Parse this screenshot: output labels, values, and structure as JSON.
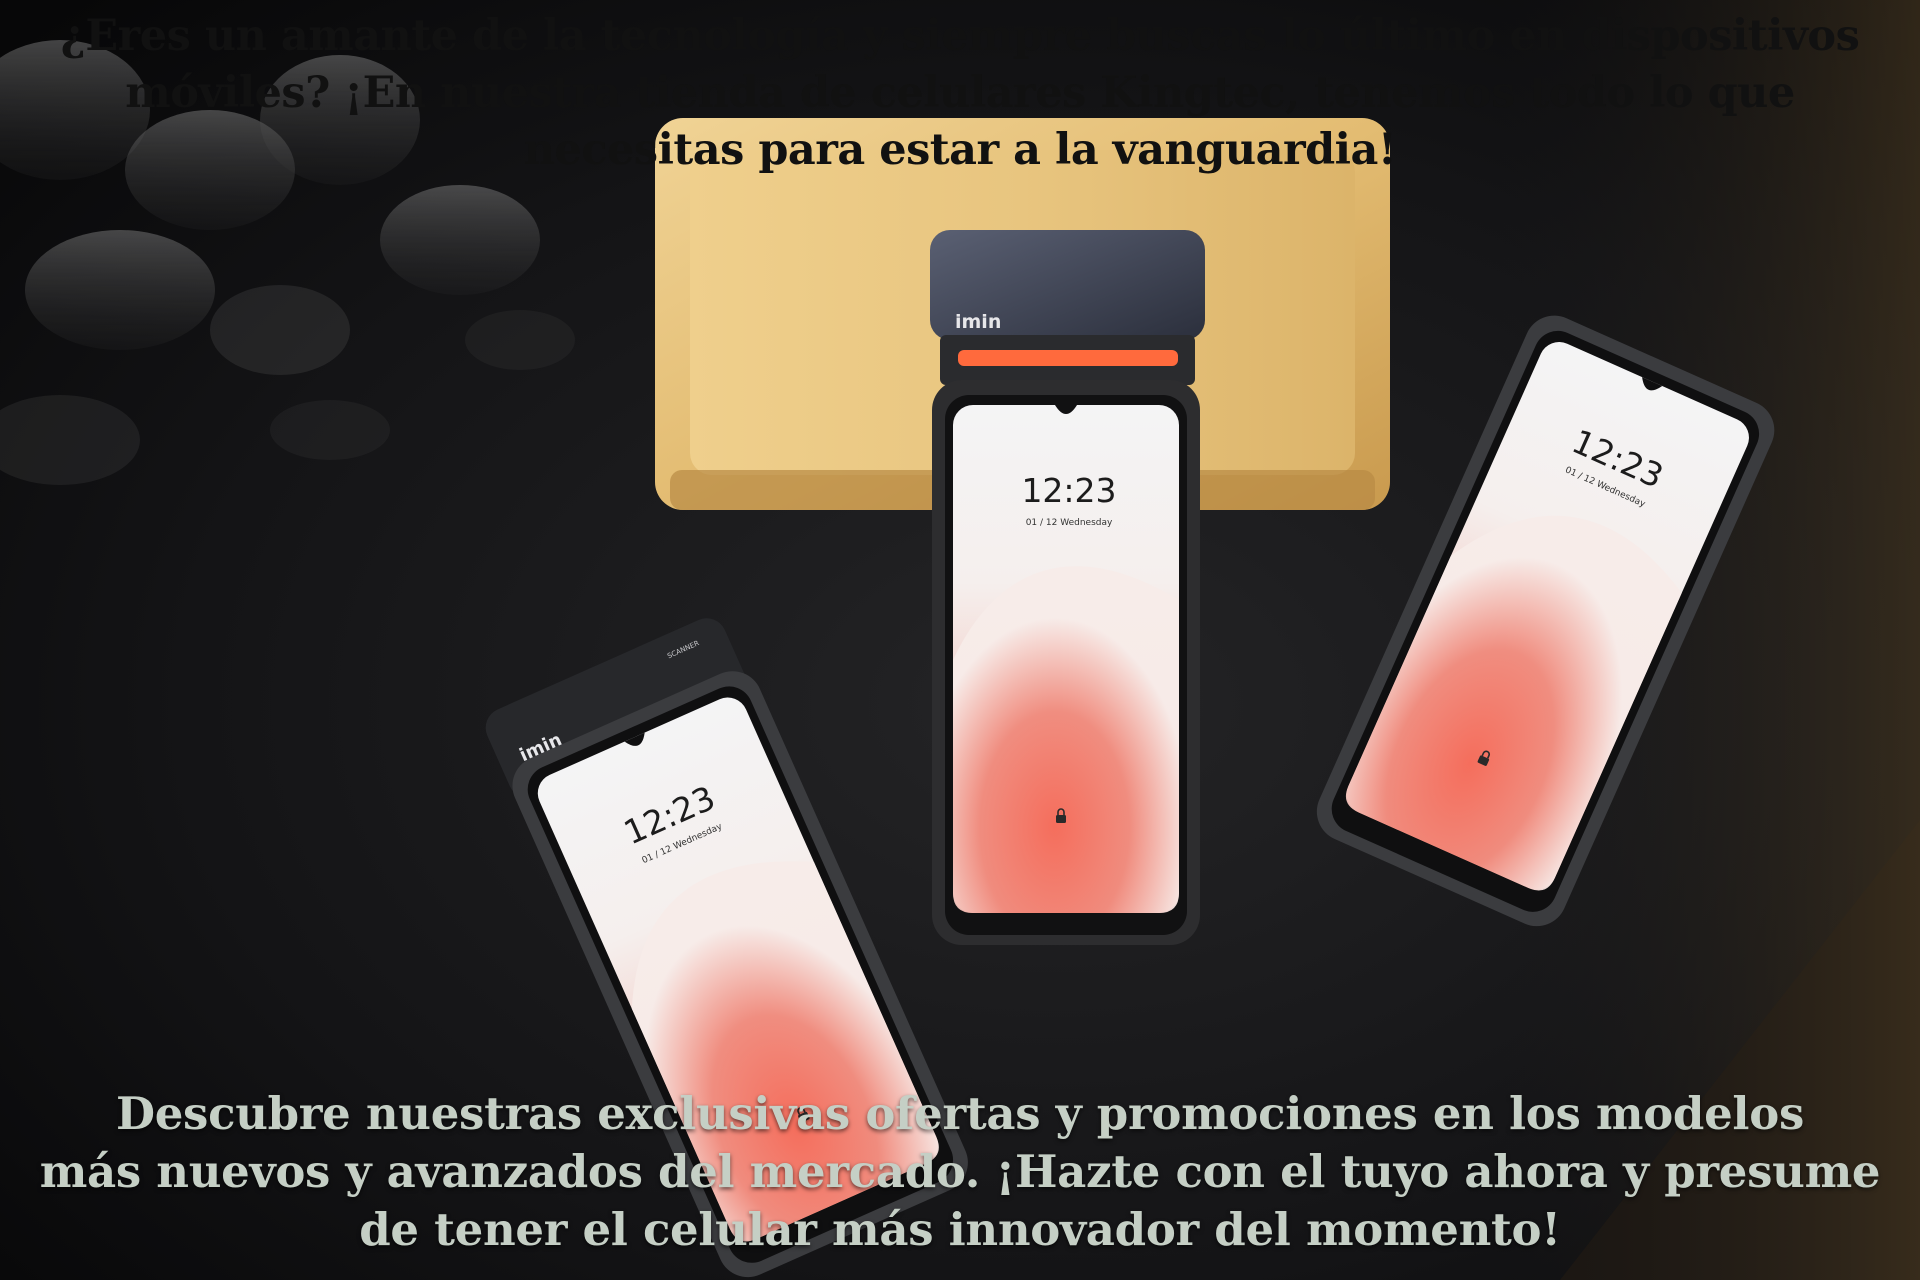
{
  "top_caption": {
    "line1": "¿Eres un amante de la tecnología y siempre buscas lo último en dispositivos",
    "line2": "móviles? ¡En nuestra tienda de celulares Kingtec, tenemos todo lo que",
    "line3": "necesitas para estar a la vanguardia!"
  },
  "bottom_caption": {
    "line1": "Descubre nuestras exclusivas ofertas y promociones en los modelos",
    "line2": "más nuevos y avanzados del mercado. ¡Hazte con el tuyo ahora y presume",
    "line3": "de tener el celular más innovador del momento!"
  },
  "devices": {
    "brand": "imin",
    "left_label": "SCANNER",
    "time": "12:23",
    "date": "01 / 12   Wednesday"
  },
  "colors": {
    "top_text": "#111111",
    "bottom_text": "#c5cfc5",
    "background": "#0d0d0e",
    "wood": "#e6c27a",
    "flower": "#f07060",
    "printer_slot": "#ff6a3d"
  },
  "icons": [
    "lock-icon"
  ]
}
